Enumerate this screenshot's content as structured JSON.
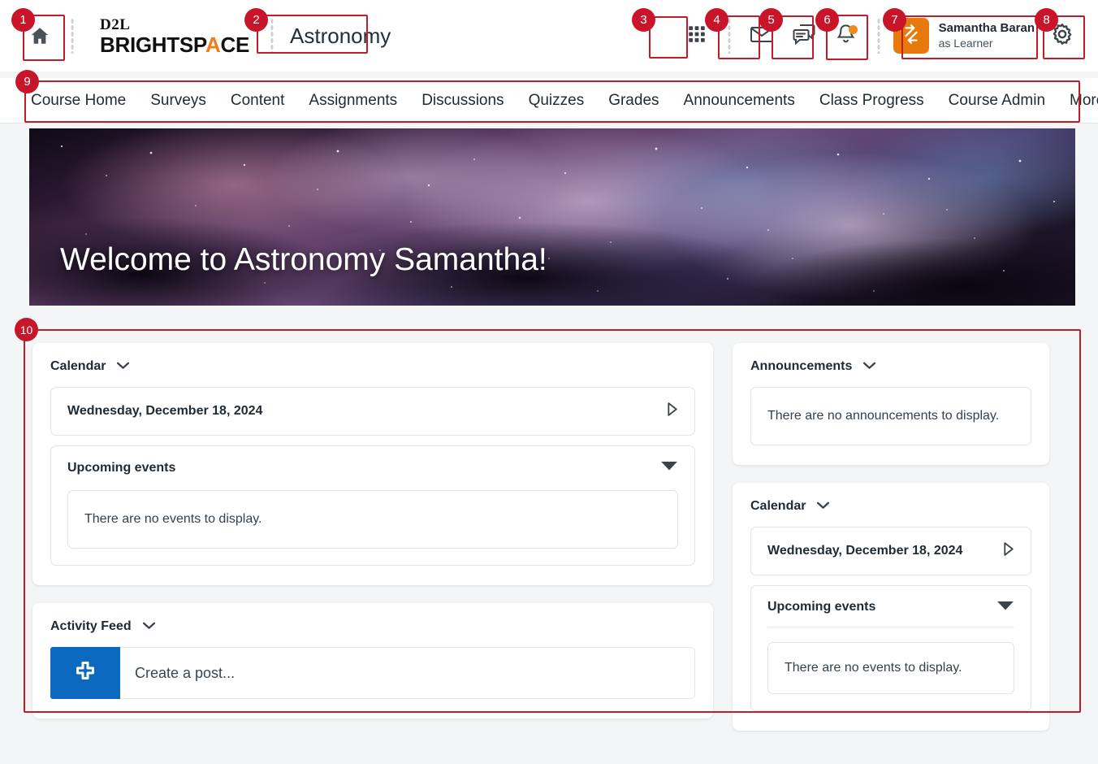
{
  "header": {
    "home_icon": "home-icon",
    "brand_line1": "D2L",
    "brand_line2_a": "BRIGHTSP",
    "brand_line2_accent": "A",
    "brand_line2_b": "CE",
    "course_title": "Astronomy",
    "waffle_icon": "waffle-grid-icon",
    "mail_icon": "envelope-icon",
    "chat_icon": "chat-bubbles-icon",
    "bell_icon": "bell-icon",
    "avatar_icon": "role-switch-arrows-icon",
    "user_name": "Samantha Baran",
    "user_role": "as Learner",
    "settings_icon": "gear-icon"
  },
  "nav": {
    "items": [
      {
        "label": "Course Home"
      },
      {
        "label": "Surveys"
      },
      {
        "label": "Content"
      },
      {
        "label": "Assignments"
      },
      {
        "label": "Discussions"
      },
      {
        "label": "Quizzes"
      },
      {
        "label": "Grades"
      },
      {
        "label": "Announcements"
      },
      {
        "label": "Class Progress"
      },
      {
        "label": "Course Admin"
      },
      {
        "label": "More"
      }
    ]
  },
  "banner": {
    "title": "Welcome to Astronomy Samantha!"
  },
  "left_column": {
    "calendar": {
      "title": "Calendar",
      "date_label": "Wednesday, December 18, 2024",
      "upcoming_label": "Upcoming events",
      "empty_text": "There are no events to display."
    },
    "activity_feed": {
      "title": "Activity Feed",
      "post_placeholder": "Create a post..."
    }
  },
  "right_column": {
    "announcements": {
      "title": "Announcements",
      "empty_text": "There are no announcements to display."
    },
    "calendar": {
      "title": "Calendar",
      "date_label": "Wednesday, December 18, 2024",
      "upcoming_label": "Upcoming events",
      "empty_text": "There are no events to display."
    }
  },
  "callouts": [
    {
      "number": "1"
    },
    {
      "number": "2"
    },
    {
      "number": "3"
    },
    {
      "number": "4"
    },
    {
      "number": "5"
    },
    {
      "number": "6"
    },
    {
      "number": "7"
    },
    {
      "number": "8"
    },
    {
      "number": "9"
    },
    {
      "number": "10"
    }
  ],
  "colors": {
    "callout_red": "#c8152a",
    "brand_orange": "#f07c1e",
    "avatar_orange": "#e8790c",
    "post_blue": "#0b69c0",
    "page_bg": "#f3f5f6"
  }
}
